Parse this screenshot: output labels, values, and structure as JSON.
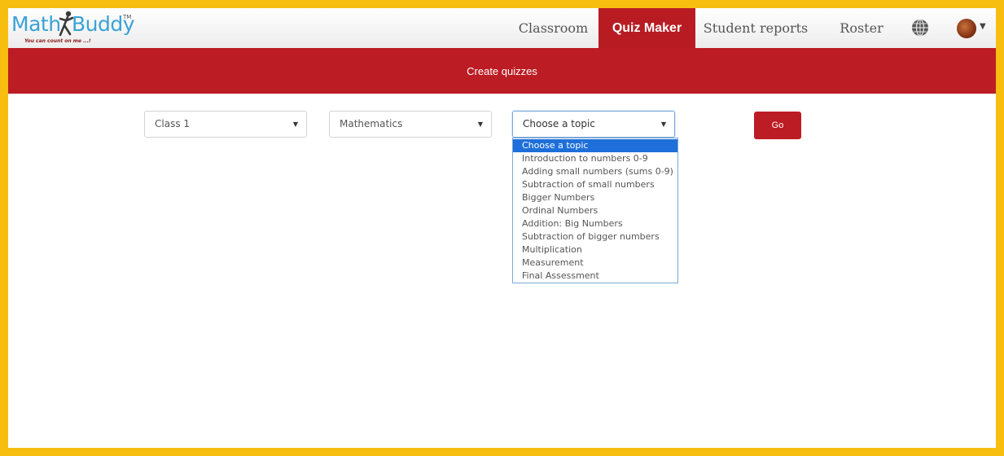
{
  "logo": {
    "word1": "Math",
    "word2": "Buddy",
    "trademark": "TM",
    "tagline": "You can count on me ...!"
  },
  "nav": {
    "items": [
      {
        "label": "Classroom"
      },
      {
        "label": "Quiz Maker",
        "active": true
      },
      {
        "label": "Student reports"
      },
      {
        "label": "Roster"
      }
    ],
    "icons": [
      "globe-icon",
      "avatar",
      "caret-down-icon"
    ]
  },
  "banner": {
    "title": "Create quizzes"
  },
  "filters": {
    "class_select": {
      "value": "Class 1"
    },
    "subject_select": {
      "value": "Mathematics"
    },
    "topic_select": {
      "value": "Choose a topic",
      "options": [
        "Choose a topic",
        "Introduction to numbers 0-9",
        "Adding small numbers (sums 0-9)",
        "Subtraction of small numbers",
        "Bigger Numbers",
        "Ordinal Numbers",
        "Addition: Big Numbers",
        "Subtraction of bigger numbers",
        "Multiplication",
        "Measurement",
        "Final Assessment"
      ],
      "highlighted_index": 0
    },
    "go_label": "Go"
  },
  "colors": {
    "brand_red": "#bc1c24",
    "frame_yellow": "#f7be10",
    "logo_blue": "#3aa2d6",
    "highlight_blue": "#1e6fd9"
  }
}
